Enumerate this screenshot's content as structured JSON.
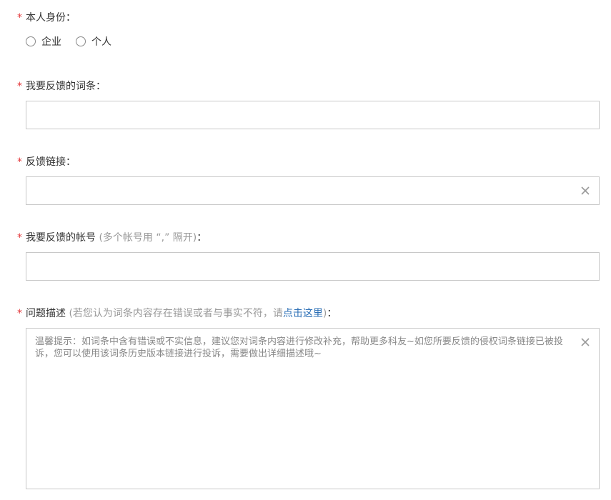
{
  "identity": {
    "required_mark": "*",
    "label": "本人身份：",
    "options": [
      {
        "label": "企业",
        "selected": false
      },
      {
        "label": "个人",
        "selected": false
      }
    ]
  },
  "entry": {
    "required_mark": "*",
    "label": "我要反馈的词条：",
    "value": ""
  },
  "link": {
    "required_mark": "*",
    "label": "反馈链接：",
    "value": "",
    "clear_icon": "close-icon"
  },
  "account": {
    "required_mark": "*",
    "label": "我要反馈的帐号",
    "hint": "(多个帐号用 “,” 隔开)",
    "suffix": "：",
    "value": ""
  },
  "description": {
    "required_mark": "*",
    "label": "问题描述",
    "hint_prefix": "(若您认为词条内容存在错误或者与事实不符，请",
    "hint_link": "点击这里",
    "hint_suffix": ")",
    "colon": "：",
    "placeholder": "温馨提示：如词条中含有错误或不实信息，建议您对词条内容进行修改补充，帮助更多科友~如您所要反馈的侵权词条链接已被投诉，您可以使用该词条历史版本链接进行投诉，需要做出详细描述哦~",
    "clear_icon": "close-icon"
  },
  "colors": {
    "required": "#e4393c",
    "hint": "#999999",
    "link": "#2b6fb6",
    "border": "#c8c8c8"
  }
}
